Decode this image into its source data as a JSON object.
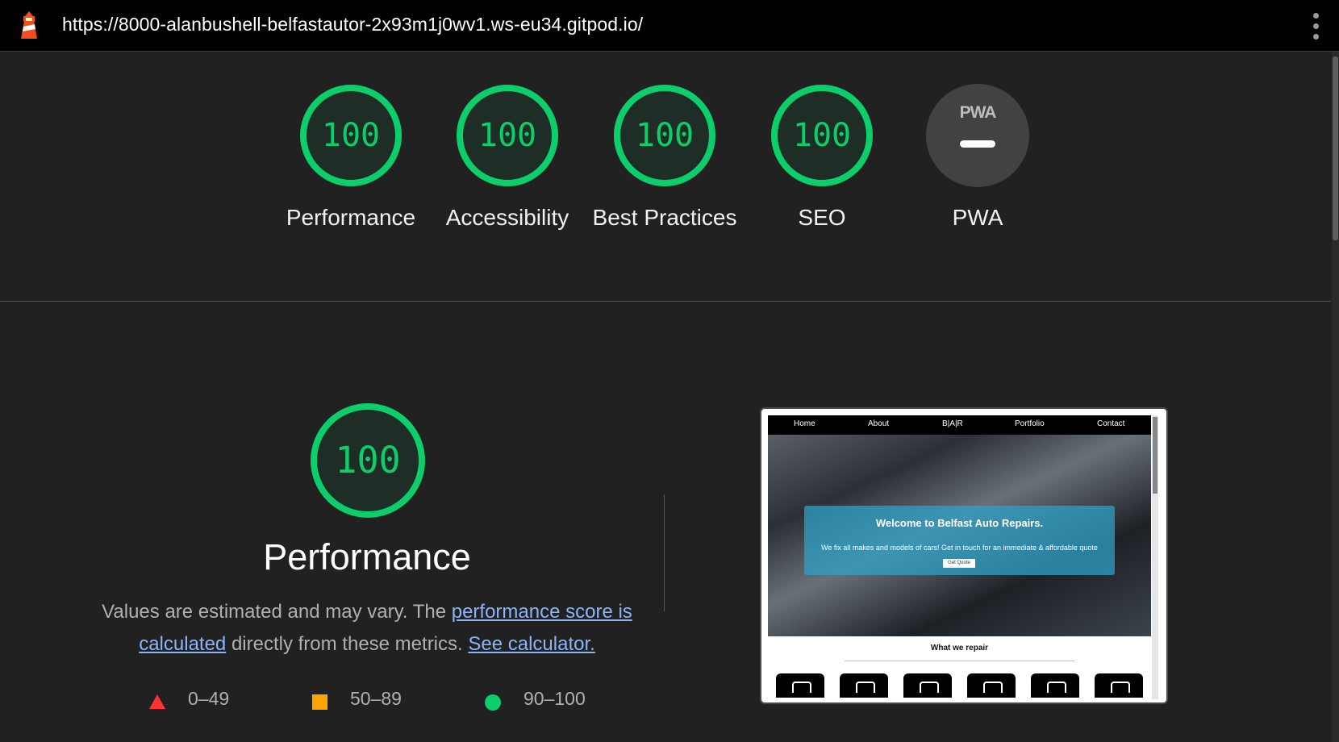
{
  "browser": {
    "url": "https://8000-alanbushell-belfastautor-2x93m1j0wv1.ws-eu34.gitpod.io/"
  },
  "colors": {
    "pass": "#0cce6b",
    "average": "#ffa400",
    "fail": "#ff3333",
    "link": "#8ab4f8",
    "background": "#212121"
  },
  "summary": [
    {
      "label": "Performance",
      "score": "100"
    },
    {
      "label": "Accessibility",
      "score": "100"
    },
    {
      "label": "Best Practices",
      "score": "100"
    },
    {
      "label": "SEO",
      "score": "100"
    },
    {
      "label": "PWA",
      "badge": "PWA"
    }
  ],
  "performance": {
    "score": "100",
    "title": "Performance",
    "desc_prefix": "Values are estimated and may vary. The ",
    "desc_link1": "performance score is calculated",
    "desc_middle": " directly from these metrics. ",
    "desc_link2": "See calculator."
  },
  "legend": [
    {
      "shape": "triangle",
      "range": "0–49"
    },
    {
      "shape": "square",
      "range": "50–89"
    },
    {
      "shape": "circle",
      "range": "90–100"
    }
  ],
  "screenshot": {
    "nav": [
      "Home",
      "About",
      "B|A|R",
      "Portfolio",
      "Contact"
    ],
    "hero_heading": "Welcome to Belfast Auto Repairs.",
    "hero_text": "We fix all makes and models of cars! Get in touch for an immediate & affordable quote",
    "hero_button": "Get Quote",
    "section_title": "What we repair"
  }
}
